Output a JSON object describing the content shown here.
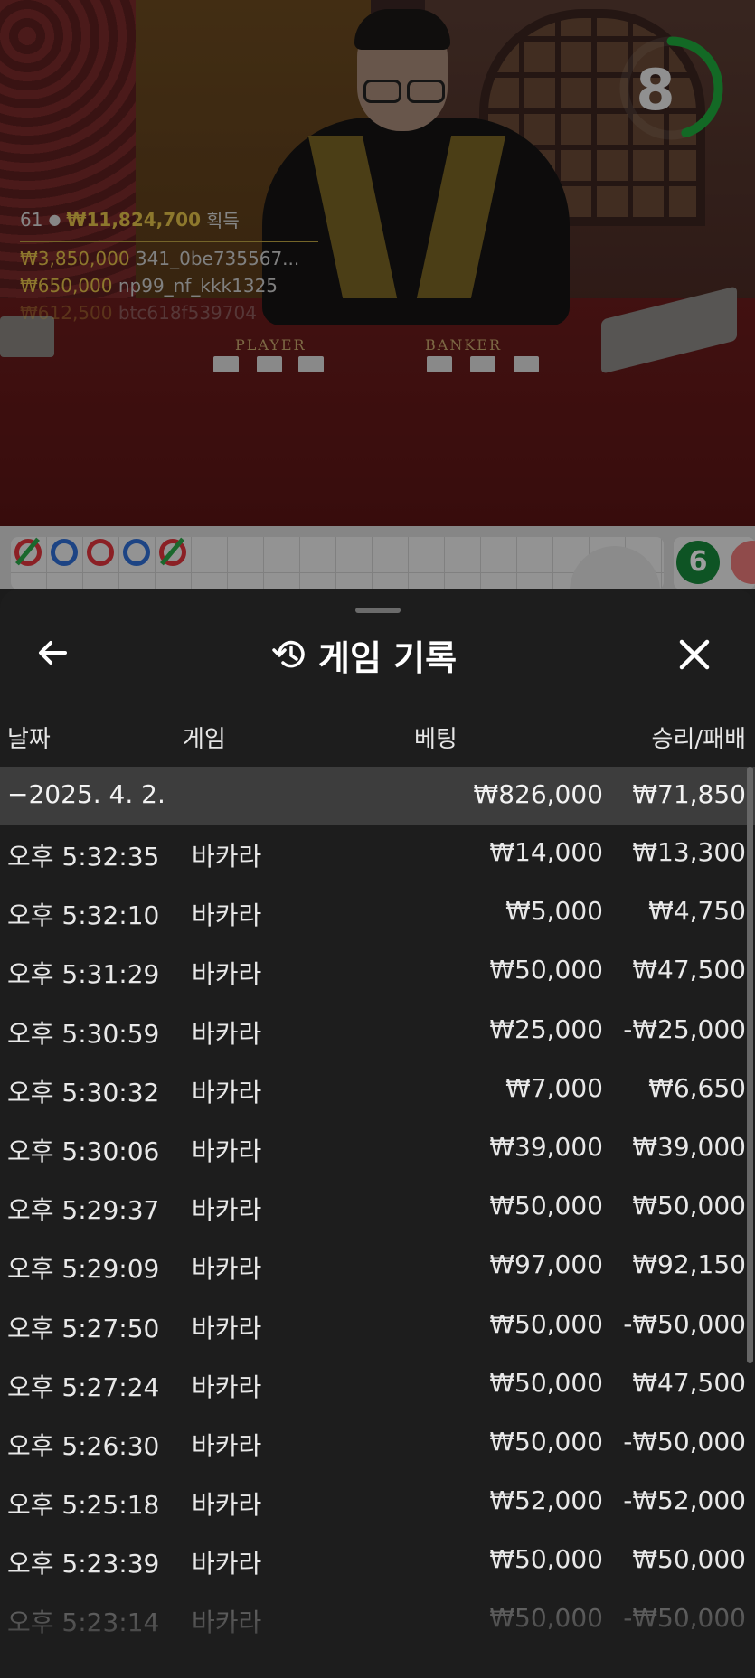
{
  "video": {
    "timer_value": "8",
    "timer_fraction": 0.45,
    "table_labels": {
      "player": "PLAYER",
      "banker": "BANKER"
    },
    "winners": {
      "count": "61",
      "total": "₩11,824,700",
      "total_suffix": "획득",
      "entries": [
        {
          "amount": "₩3,850,000",
          "name": "341_0be735567..."
        },
        {
          "amount": "₩650,000",
          "name": "np99_nf_kkk1325"
        },
        {
          "amount": "₩612,500",
          "name": "btc618f539704"
        }
      ]
    }
  },
  "road": {
    "badge_value": "6"
  },
  "sheet": {
    "title": "게임 기록",
    "back_icon": "arrow-left-icon",
    "history_icon": "history-clock-icon",
    "close_icon": "close-x-icon",
    "columns": {
      "date": "날짜",
      "game": "게임",
      "bet": "베팅",
      "result": "승리/패배"
    },
    "summary": {
      "date": "−2025. 4. 2.",
      "bet": "₩826,000",
      "result": "₩71,850"
    },
    "rows": [
      {
        "time": "오후 5:32:35",
        "game": "바카라",
        "bet": "₩14,000",
        "result": "₩13,300"
      },
      {
        "time": "오후 5:32:10",
        "game": "바카라",
        "bet": "₩5,000",
        "result": "₩4,750"
      },
      {
        "time": "오후 5:31:29",
        "game": "바카라",
        "bet": "₩50,000",
        "result": "₩47,500"
      },
      {
        "time": "오후 5:30:59",
        "game": "바카라",
        "bet": "₩25,000",
        "result": "-₩25,000"
      },
      {
        "time": "오후 5:30:32",
        "game": "바카라",
        "bet": "₩7,000",
        "result": "₩6,650"
      },
      {
        "time": "오후 5:30:06",
        "game": "바카라",
        "bet": "₩39,000",
        "result": "₩39,000"
      },
      {
        "time": "오후 5:29:37",
        "game": "바카라",
        "bet": "₩50,000",
        "result": "₩50,000"
      },
      {
        "time": "오후 5:29:09",
        "game": "바카라",
        "bet": "₩97,000",
        "result": "₩92,150"
      },
      {
        "time": "오후 5:27:50",
        "game": "바카라",
        "bet": "₩50,000",
        "result": "-₩50,000"
      },
      {
        "time": "오후 5:27:24",
        "game": "바카라",
        "bet": "₩50,000",
        "result": "₩47,500"
      },
      {
        "time": "오후 5:26:30",
        "game": "바카라",
        "bet": "₩50,000",
        "result": "-₩50,000"
      },
      {
        "time": "오후 5:25:18",
        "game": "바카라",
        "bet": "₩52,000",
        "result": "-₩52,000"
      },
      {
        "time": "오후 5:23:39",
        "game": "바카라",
        "bet": "₩50,000",
        "result": "₩50,000"
      },
      {
        "time": "오후 5:23:14",
        "game": "바카라",
        "bet": "₩50,000",
        "result": "-₩50,000"
      }
    ]
  },
  "colors": {
    "timer_ring": "#1faa3c",
    "gold": "#e4c24a",
    "sheet_bg": "#1d1d1d",
    "summary_bg": "#3d3d3d"
  }
}
